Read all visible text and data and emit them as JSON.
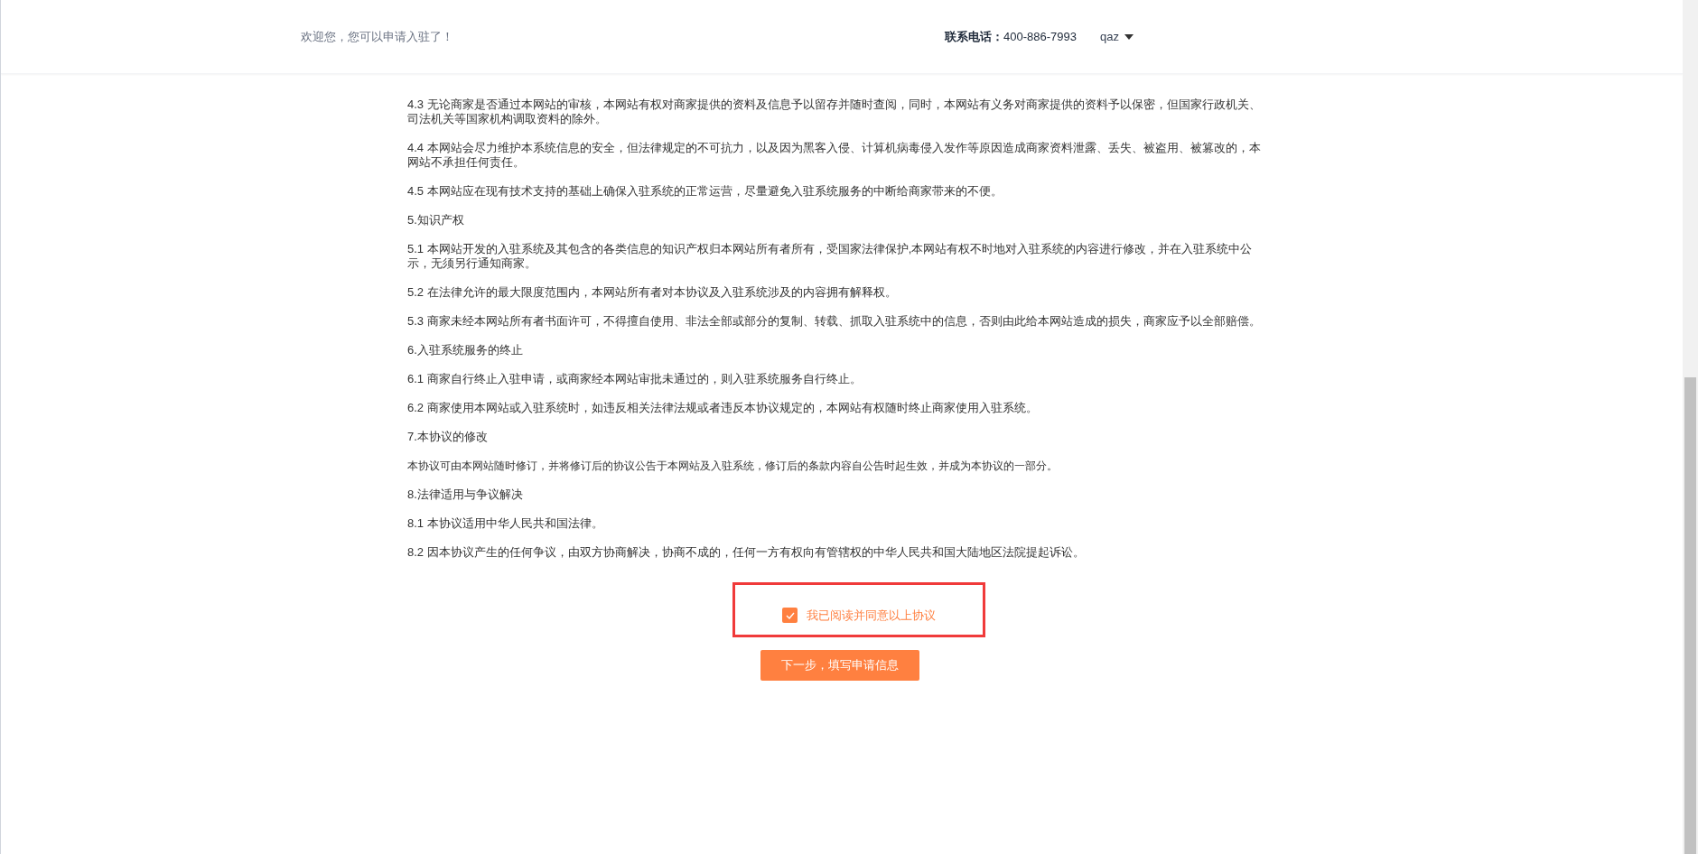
{
  "header": {
    "welcome": "欢迎您，您可以申请入驻了！",
    "contact": "**联系电话：**400-886-7993",
    "user": "qaz"
  },
  "paragraphs": [
    {
      "kind": "clause",
      "text": "4.3 无论商家是否通过本网站的审核，本网站有权对商家提供的资料及信息予以留存并随时查阅，同时，本网站有义务对商家提供的资料予以保密，但国家行政机关、司法机关等国家机构调取资料的除外。"
    },
    {
      "kind": "clause",
      "text": "4.4 本网站会尽力维护本系统信息的安全，但法律规定的不可抗力，以及因为黑客入侵、计算机病毒侵入发作等原因造成商家资料泄露、丢失、被盗用、被篡改的，本网站不承担任何责任。"
    },
    {
      "kind": "clause",
      "text": "4.5 本网站应在现有技术支持的基础上确保入驻系统的正常运营，尽量避免入驻系统服务的中断给商家带来的不便。"
    },
    {
      "kind": "clause",
      "text": "5.知识产权"
    },
    {
      "kind": "clause",
      "text": "5.1 本网站开发的入驻系统及其包含的各类信息的知识产权归本网站所有者所有，受国家法律保护,本网站有权不时地对入驻系统的内容进行修改，并在入驻系统中公示，无须另行通知商家。"
    },
    {
      "kind": "clause",
      "text": "5.2 在法律允许的最大限度范围内，本网站所有者对本协议及入驻系统涉及的内容拥有解释权。"
    },
    {
      "kind": "clause",
      "text": "5.3 商家未经本网站所有者书面许可，不得擅自使用、非法全部或部分的复制、转载、抓取入驻系统中的信息，否则由此给本网站造成的损失，商家应予以全部赔偿。"
    },
    {
      "kind": "clause",
      "text": "6.入驻系统服务的终止"
    },
    {
      "kind": "clause",
      "text": "6.1 商家自行终止入驻申请，或商家经本网站审批未通过的，则入驻系统服务自行终止。"
    },
    {
      "kind": "clause",
      "text": "6.2 商家使用本网站或入驻系统时，如违反相关法律法规或者违反本协议规定的，本网站有权随时终止商家使用入驻系统。"
    },
    {
      "kind": "clause",
      "text": "7.本协议的修改"
    },
    {
      "kind": "small",
      "text": "本协议可由本网站随时修订，并将修订后的协议公告于本网站及入驻系统，修订后的条款内容自公告时起生效，并成为本协议的一部分。"
    },
    {
      "kind": "clause",
      "text": "8.法律适用与争议解决"
    },
    {
      "kind": "clause",
      "text": "8.1 本协议适用中华人民共和国法律。"
    },
    {
      "kind": "clause",
      "text": "8.2 因本协议产生的任何争议，由双方协商解决，协商不成的，任何一方有权向有管辖权的中华人民共和国大陆地区法院提起诉讼。"
    }
  ],
  "agreement": {
    "label": "我已阅读并同意以上协议",
    "checked": true,
    "highlighted": true
  },
  "next_button": "下一步，填写申请信息"
}
